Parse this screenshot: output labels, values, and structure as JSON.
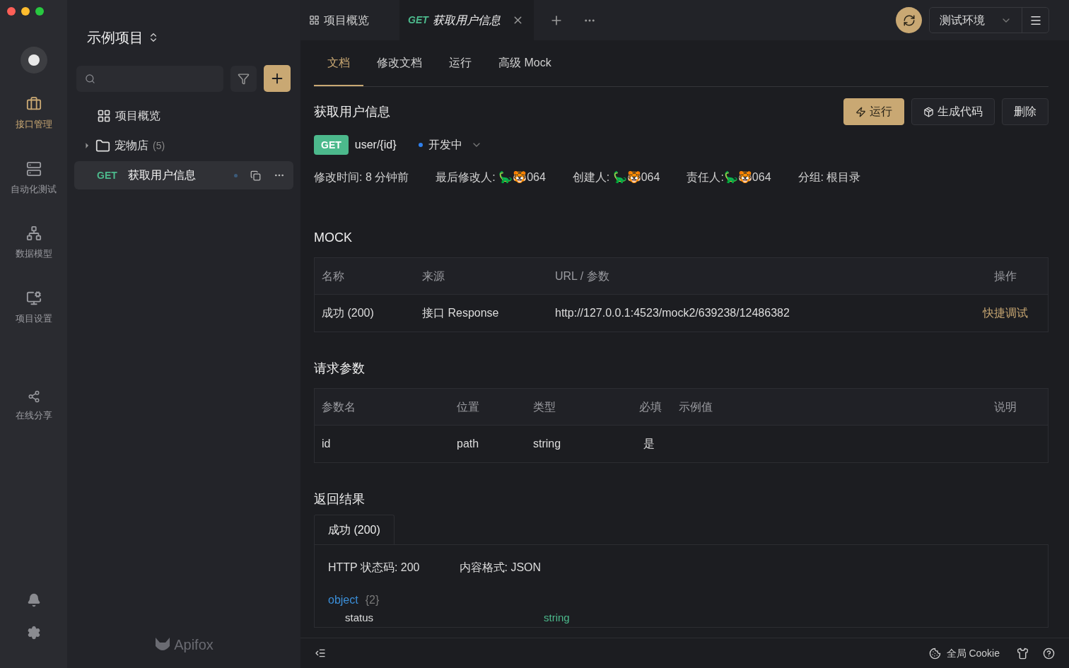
{
  "rail": {
    "items": [
      {
        "kind": "api",
        "label": "接口管理",
        "selected": true
      },
      {
        "kind": "test",
        "label": "自动化测试",
        "selected": false
      },
      {
        "kind": "model",
        "label": "数据模型",
        "selected": false
      },
      {
        "kind": "settings",
        "label": "项目设置",
        "selected": false
      },
      {
        "kind": "share",
        "label": "在线分享",
        "selected": false
      }
    ]
  },
  "project": {
    "title": "示例项目"
  },
  "tree": [
    {
      "kind": "overview",
      "label": "项目概览"
    },
    {
      "kind": "folder",
      "label": "宠物店",
      "count": "(5)",
      "expanded": false
    },
    {
      "kind": "endpoint",
      "method": "GET",
      "label": "获取用户信息",
      "selected": true
    }
  ],
  "brand": "Apifox",
  "tabs": [
    {
      "kind": "overview",
      "label": "项目概览",
      "selected": false
    },
    {
      "kind": "endpoint",
      "method": "GET",
      "label": "获取用户信息",
      "selected": true
    }
  ],
  "environment": "测试环境",
  "doc_tabs": [
    {
      "label": "文档",
      "selected": true
    },
    {
      "label": "修改文档",
      "selected": false
    },
    {
      "label": "运行",
      "selected": false
    },
    {
      "label": "高级 Mock",
      "selected": false
    }
  ],
  "endpoint": {
    "title": "获取用户信息",
    "method": "GET",
    "path": "user/{id}",
    "status": "开发中"
  },
  "actions": [
    {
      "kind": "primary",
      "label": "运行"
    },
    {
      "kind": "code",
      "label": "生成代码"
    },
    {
      "kind": "plain",
      "label": "删除"
    }
  ],
  "meta": [
    "修改时间: 8 分钟前",
    "最后修改人: 🦕🐯064",
    "创建人: 🦕🐯064",
    "责任人:🦕🐯064",
    "分组: 根目录"
  ],
  "mock": {
    "title": "MOCK",
    "columns": [
      "名称",
      "来源",
      "URL / 参数",
      "操作"
    ],
    "rows": [
      {
        "name": "成功 (200)",
        "source": "接口 Response",
        "url": "http://127.0.0.1:4523/mock2/639238/12486382",
        "action": "快捷调试"
      }
    ]
  },
  "params": {
    "title": "请求参数",
    "columns": [
      "参数名",
      "位置",
      "类型",
      "必填",
      "示例值",
      "说明"
    ],
    "rows": [
      {
        "name": "id",
        "location": "path",
        "type": "string",
        "required": "是"
      }
    ]
  },
  "response": {
    "title": "返回结果",
    "tabs": [
      {
        "label": "成功 (200)",
        "selected": true
      }
    ],
    "status_code": "HTTP 状态码: 200",
    "format": "内容格式: JSON",
    "schema": {
      "type": "object",
      "count": "{2}",
      "fields": [
        {
          "name": "status",
          "type": "string"
        }
      ]
    }
  },
  "footer": {
    "cookie": "全局 Cookie"
  }
}
